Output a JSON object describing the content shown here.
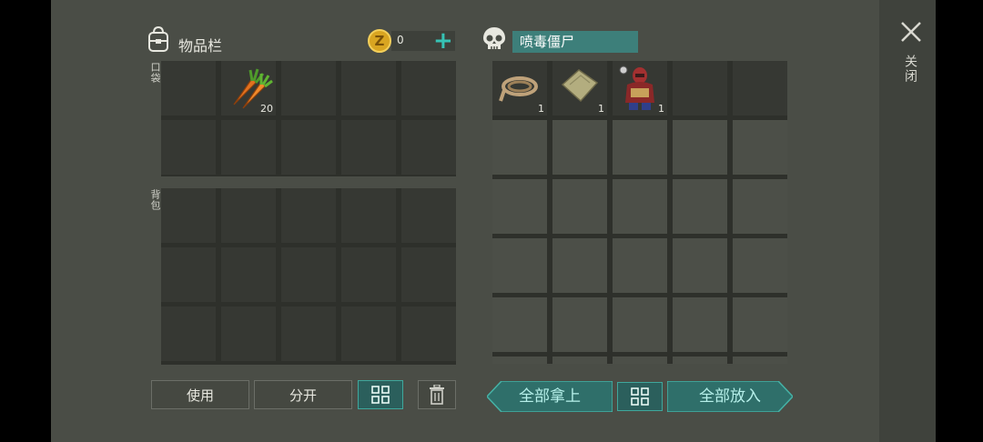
{
  "inventory": {
    "title": "物品栏",
    "coin_value": "0",
    "pocket_label": "口袋",
    "backpack_label": "背包",
    "pocket_items": [
      {
        "slot": 1,
        "name": "carrot",
        "count": "20"
      }
    ]
  },
  "container": {
    "title": "喷毒僵尸",
    "items": [
      {
        "slot": 0,
        "name": "rope",
        "count": "1"
      },
      {
        "slot": 1,
        "name": "cloth-scrap",
        "count": "1"
      },
      {
        "slot": 2,
        "name": "bomber-zombie-outfit",
        "count": "1"
      }
    ]
  },
  "buttons": {
    "use": "使用",
    "split": "分开",
    "take_all": "全部拿上",
    "put_all": "全部放入"
  },
  "close": {
    "label": "关闭"
  },
  "icons": {
    "backpack": "backpack-icon",
    "coin": "coin-icon",
    "add": "plus-icon",
    "skull": "skull-icon",
    "sort": "grid-sort-icon",
    "trash": "trash-icon",
    "close": "close-icon"
  },
  "colors": {
    "accent": "#36c3b5",
    "panel": "#4a4d46",
    "slot": "#363833"
  }
}
